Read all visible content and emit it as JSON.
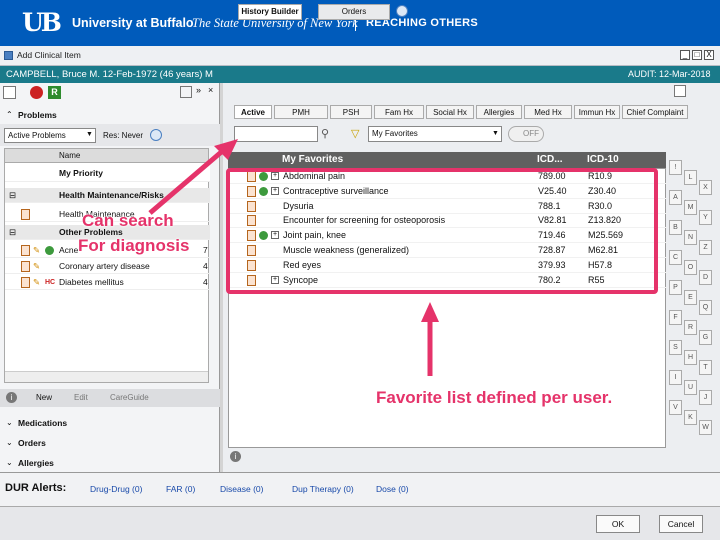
{
  "banner": {
    "logo": "UB",
    "university": "University at Buffalo",
    "tagline": "The State University of New York",
    "slogan": "REACHING OTHERS",
    "bg_color": "#005bbb"
  },
  "window": {
    "title": "Add Clinical Item",
    "minimize": "_",
    "maximize": "□",
    "close": "X"
  },
  "patient": {
    "line": "CAMPBELL, Bruce M.  12-Feb-1972  (46 years)  M",
    "audit": "AUDIT: 12-Mar-2018"
  },
  "left": {
    "problems_header": "Problems",
    "filter_value": "Active Problems",
    "res_label": "Res: Never",
    "col_name": "Name",
    "rows": [
      {
        "text": "My Priority",
        "type": "group"
      },
      {
        "text": "Health Maintenance/Risks",
        "type": "group"
      },
      {
        "text": "Health Maintenance",
        "type": "item"
      },
      {
        "text": "Other Problems",
        "type": "group"
      },
      {
        "text": "Acne",
        "type": "item",
        "num": "7"
      },
      {
        "text": "Coronary artery disease",
        "type": "item",
        "num": "4"
      },
      {
        "text": "Diabetes mellitus",
        "type": "item",
        "num": "4"
      }
    ],
    "new_btn": "New",
    "edit_btn": "Edit",
    "careguide_btn": "CareGuide",
    "medications": "Medications",
    "orders": "Orders",
    "allergies": "Allergies"
  },
  "right": {
    "tabs_top": [
      "History Builder",
      "Orders"
    ],
    "tabs": [
      "Active",
      "PMH",
      "PSH",
      "Fam Hx",
      "Social Hx",
      "Allergies",
      "Med Hx",
      "Immun Hx",
      "Chief Complaint"
    ],
    "search_value": "",
    "favorites_select": "My Favorites",
    "off_toggle": "OFF",
    "col_favorites": "My Favorites",
    "col_icd": "ICD...",
    "col_icd10": "ICD-10",
    "rows": [
      {
        "name": "Abdominal pain",
        "icd": "789.00",
        "icd10": "R10.9",
        "green": true,
        "expand": true
      },
      {
        "name": "Contraceptive surveillance",
        "icd": "V25.40",
        "icd10": "Z30.40",
        "green": true,
        "expand": true
      },
      {
        "name": "Dysuria",
        "icd": "788.1",
        "icd10": "R30.0",
        "green": false,
        "expand": false
      },
      {
        "name": "Encounter for screening for osteoporosis",
        "icd": "V82.81",
        "icd10": "Z13.820",
        "green": false,
        "expand": false
      },
      {
        "name": "Joint pain, knee",
        "icd": "719.46",
        "icd10": "M25.569",
        "green": true,
        "expand": true
      },
      {
        "name": "Muscle weakness (generalized)",
        "icd": "728.87",
        "icd10": "M62.81",
        "green": false,
        "expand": false
      },
      {
        "name": "Red eyes",
        "icd": "379.93",
        "icd10": "H57.8",
        "green": false,
        "expand": false
      },
      {
        "name": "Syncope",
        "icd": "780.2",
        "icd10": "R55",
        "green": false,
        "expand": true
      }
    ],
    "alpha": [
      "!",
      "L",
      "X",
      "A",
      "M",
      "Y",
      "B",
      "N",
      "Z",
      "C",
      "O",
      "D",
      "P",
      "E",
      "Q",
      "F",
      "R",
      "G",
      "S",
      "H",
      "T",
      "I",
      "U",
      "J",
      "V",
      "K",
      "W"
    ]
  },
  "annotations": {
    "search_note_1": "Can search",
    "search_note_2": "For diagnosis",
    "favorites_note": "Favorite list defined per user.",
    "color": "#e5336a"
  },
  "dur": {
    "label": "DUR Alerts:",
    "links": [
      "Drug-Drug (0)",
      "FAR (0)",
      "Disease (0)",
      "Dup Therapy (0)",
      "Dose (0)"
    ]
  },
  "footer": {
    "ok": "OK",
    "cancel": "Cancel"
  }
}
